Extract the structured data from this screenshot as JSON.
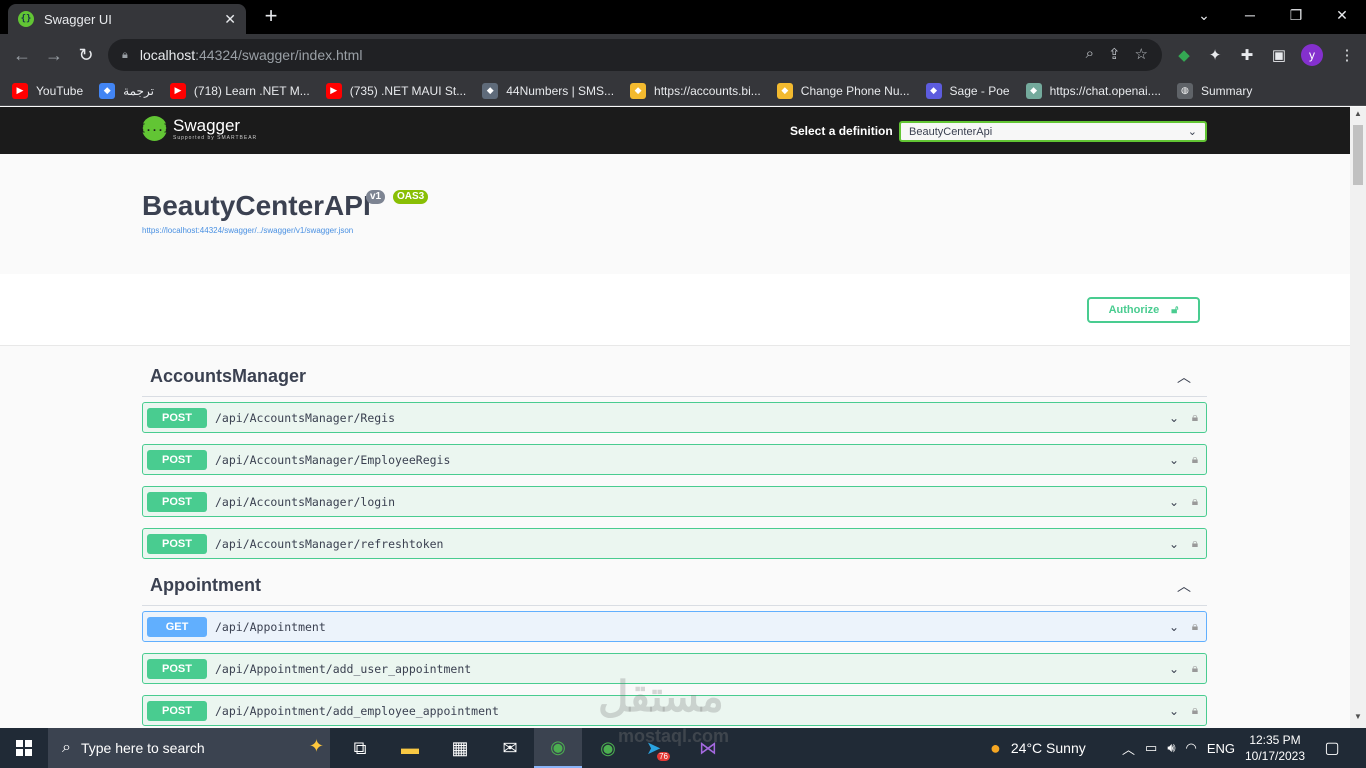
{
  "browser": {
    "tab_title": "Swagger UI",
    "url_host": "localhost",
    "url_path": ":44324/swagger/index.html",
    "profile_initial": "y",
    "bookmarks": [
      {
        "label": "YouTube",
        "icon": "youtube-icon",
        "color": "#ff0000"
      },
      {
        "label": "ترجمة",
        "icon": "translate-icon",
        "color": "#4285f4"
      },
      {
        "label": "(718) Learn .NET M...",
        "icon": "youtube-icon",
        "color": "#ff0000"
      },
      {
        "label": "(735) .NET MAUI St...",
        "icon": "youtube-icon",
        "color": "#ff0000"
      },
      {
        "label": "44Numbers | SMS...",
        "icon": "numbers-icon",
        "color": "#5f6b7a"
      },
      {
        "label": "https://accounts.bi...",
        "icon": "binance-icon",
        "color": "#f3ba2f"
      },
      {
        "label": "Change Phone Nu...",
        "icon": "binance-icon",
        "color": "#f3ba2f"
      },
      {
        "label": "Sage - Poe",
        "icon": "poe-icon",
        "color": "#5d5cde"
      },
      {
        "label": "https://chat.openai....",
        "icon": "openai-icon",
        "color": "#74aa9c"
      },
      {
        "label": "Summary",
        "icon": "globe-icon",
        "color": "#5f6368"
      }
    ]
  },
  "swagger": {
    "brand": "Swagger",
    "brand_sub": "Supported by SMARTBEAR",
    "definition_label": "Select a definition",
    "definition_value": "BeautyCenterApi",
    "api_title": "BeautyCenterAPI",
    "version_badge": "v1",
    "oas_badge": "OAS3",
    "spec_url": "https://localhost:44324/swagger/../swagger/v1/swagger.json",
    "authorize_label": "Authorize",
    "colors": {
      "post": "#49cc90",
      "get": "#61affe",
      "brand_green": "#62c534"
    },
    "sections": [
      {
        "title": "AccountsManager",
        "operations": [
          {
            "method": "POST",
            "path": "/api/AccountsManager/Regis"
          },
          {
            "method": "POST",
            "path": "/api/AccountsManager/EmployeeRegis"
          },
          {
            "method": "POST",
            "path": "/api/AccountsManager/login"
          },
          {
            "method": "POST",
            "path": "/api/AccountsManager/refreshtoken"
          }
        ]
      },
      {
        "title": "Appointment",
        "operations": [
          {
            "method": "GET",
            "path": "/api/Appointment"
          },
          {
            "method": "POST",
            "path": "/api/Appointment/add_user_appointment"
          },
          {
            "method": "POST",
            "path": "/api/Appointment/add_employee_appointment"
          }
        ]
      }
    ]
  },
  "taskbar": {
    "search_placeholder": "Type here to search",
    "weather": "24°C  Sunny",
    "language": "ENG",
    "time": "12:35 PM",
    "date": "10/17/2023",
    "telegram_badge": "76"
  },
  "watermark": {
    "arabic": "مستقل",
    "latin": "mostaql.com"
  }
}
